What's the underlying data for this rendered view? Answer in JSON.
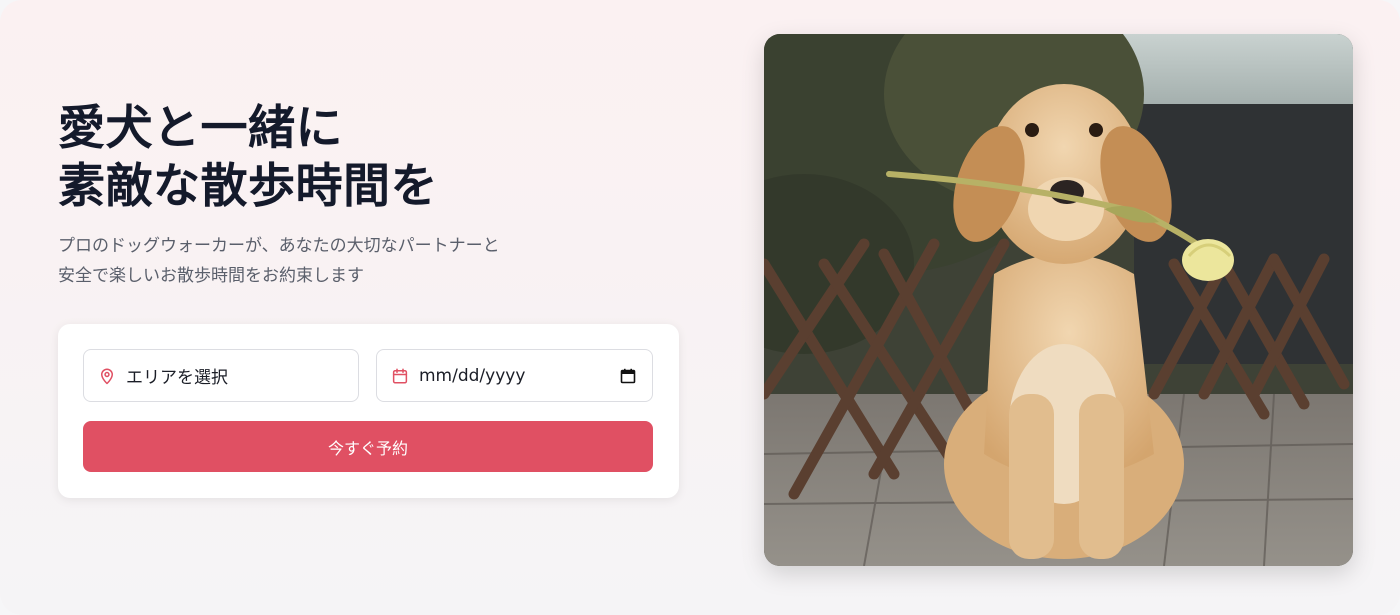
{
  "hero": {
    "title_line1": "愛犬と一緒に",
    "title_line2": "素敵な散歩時間を",
    "subtitle_line1": "プロのドッグウォーカーが、あなたの大切なパートナーと",
    "subtitle_line2": "安全で楽しいお散歩時間をお約束します"
  },
  "booking": {
    "area_placeholder": "エリアを選択",
    "area_icon": "map-pin-icon",
    "date_placeholder": "mm/dd/yyyy",
    "date_icon": "calendar-icon",
    "submit_label": "今すぐ予約"
  },
  "colors": {
    "accent": "#e05063",
    "title": "#141a2b",
    "subtitle": "#5a5f6b"
  },
  "image": {
    "subject": "golden-retriever-puppy-holding-tulip"
  }
}
